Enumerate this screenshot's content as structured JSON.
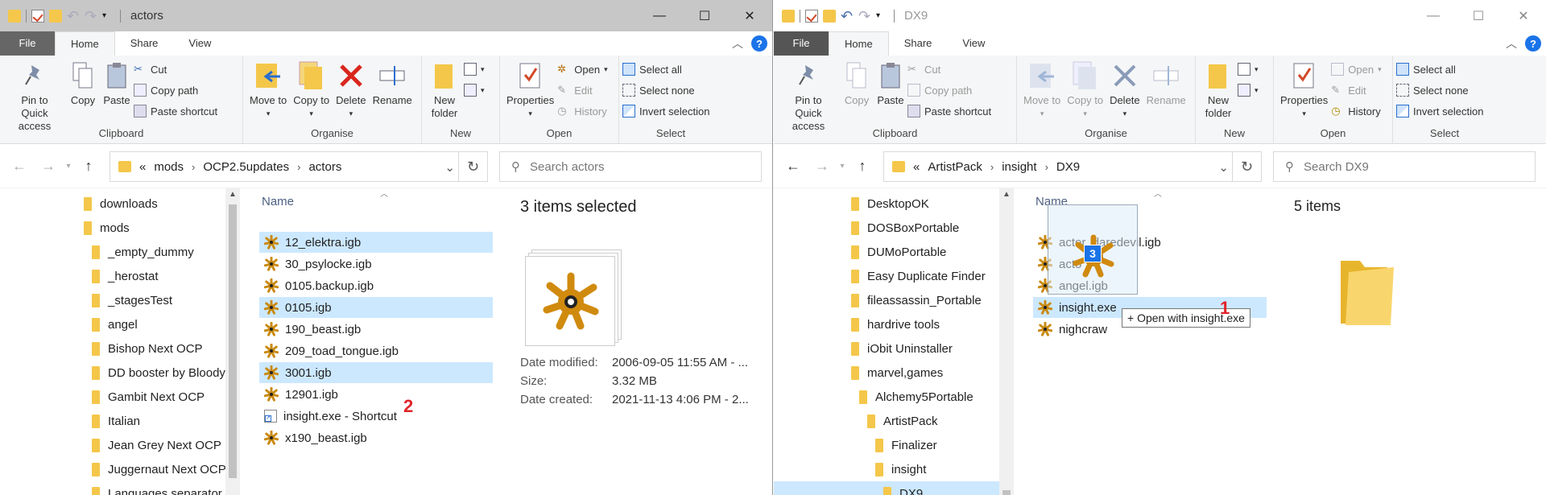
{
  "left": {
    "title": "actors",
    "tabs": {
      "file": "File",
      "home": "Home",
      "share": "Share",
      "view": "View"
    },
    "ribbon": {
      "clipboard": {
        "label": "Clipboard",
        "pin": "Pin to Quick access",
        "copy": "Copy",
        "paste": "Paste",
        "cut": "Cut",
        "copy_path": "Copy path",
        "paste_shortcut": "Paste shortcut"
      },
      "organise": {
        "label": "Organise",
        "move_to": "Move to",
        "copy_to": "Copy to",
        "delete": "Delete",
        "rename": "Rename"
      },
      "new": {
        "label": "New",
        "new_folder": "New folder"
      },
      "open": {
        "label": "Open",
        "properties": "Properties",
        "open": "Open",
        "edit": "Edit",
        "history": "History"
      },
      "select": {
        "label": "Select",
        "select_all": "Select all",
        "select_none": "Select none",
        "invert": "Invert selection"
      }
    },
    "breadcrumb": {
      "overflow": "«",
      "parts": [
        "mods",
        "OCP2.5updates",
        "actors"
      ]
    },
    "search_placeholder": "Search actors",
    "nav": [
      "downloads",
      "mods",
      "_empty_dummy",
      "_herostat",
      "_stagesTest",
      "angel",
      "Bishop Next OCP",
      "DD booster by Bloody",
      "Gambit Next OCP",
      "Italian",
      "Jean Grey Next OCP",
      "Juggernaut Next OCP",
      "Languages separator"
    ],
    "col_name": "Name",
    "files": [
      "12_elektra.igb",
      "30_psylocke.igb",
      "0105.backup.igb",
      "0105.igb",
      "190_beast.igb",
      "209_toad_tongue.igb",
      "3001.igb",
      "12901.igb",
      "insight.exe - Shortcut",
      "x190_beast.igb"
    ],
    "selected_files": [
      0,
      3,
      6
    ],
    "annotation": "2",
    "details": {
      "title": "3 items selected",
      "props": [
        {
          "k": "Date modified:",
          "v": "2006-09-05 11:55 AM - ..."
        },
        {
          "k": "Size:",
          "v": "3.32 MB"
        },
        {
          "k": "Date created:",
          "v": "2021-11-13 4:06 PM - 2..."
        }
      ]
    }
  },
  "right": {
    "title": "DX9",
    "tabs": {
      "file": "File",
      "home": "Home",
      "share": "Share",
      "view": "View"
    },
    "ribbon": {
      "clipboard": {
        "label": "Clipboard",
        "pin": "Pin to Quick access",
        "copy": "Copy",
        "paste": "Paste",
        "cut": "Cut",
        "copy_path": "Copy path",
        "paste_shortcut": "Paste shortcut"
      },
      "organise": {
        "label": "Organise",
        "move_to": "Move to",
        "copy_to": "Copy to",
        "delete": "Delete",
        "rename": "Rename"
      },
      "new": {
        "label": "New",
        "new_folder": "New folder"
      },
      "open": {
        "label": "Open",
        "properties": "Properties",
        "open": "Open",
        "edit": "Edit",
        "history": "History"
      },
      "select": {
        "label": "Select",
        "select_all": "Select all",
        "select_none": "Select none",
        "invert": "Invert selection"
      }
    },
    "breadcrumb": {
      "overflow": "«",
      "parts": [
        "ArtistPack",
        "insight",
        "DX9"
      ]
    },
    "search_placeholder": "Search DX9",
    "nav": [
      "DesktopOK",
      "DOSBoxPortable",
      "DUMoPortable",
      "Easy Duplicate Finder",
      "fileassassin_Portable",
      "hardrive tools",
      "iObit Uninstaller",
      "marvel,games",
      "Alchemy5Portable",
      "ArtistPack",
      "Finalizer",
      "insight",
      "DX9"
    ],
    "col_name": "Name",
    "files": [
      "actor_daredevil.igb",
      "acto",
      "angel.igb",
      "insight.exe",
      "nighcraw"
    ],
    "selected_files": [
      3
    ],
    "annotation": "1",
    "drag_count": "3",
    "tooltip": "+ Open with insight.exe",
    "details": {
      "title": "5 items"
    }
  }
}
